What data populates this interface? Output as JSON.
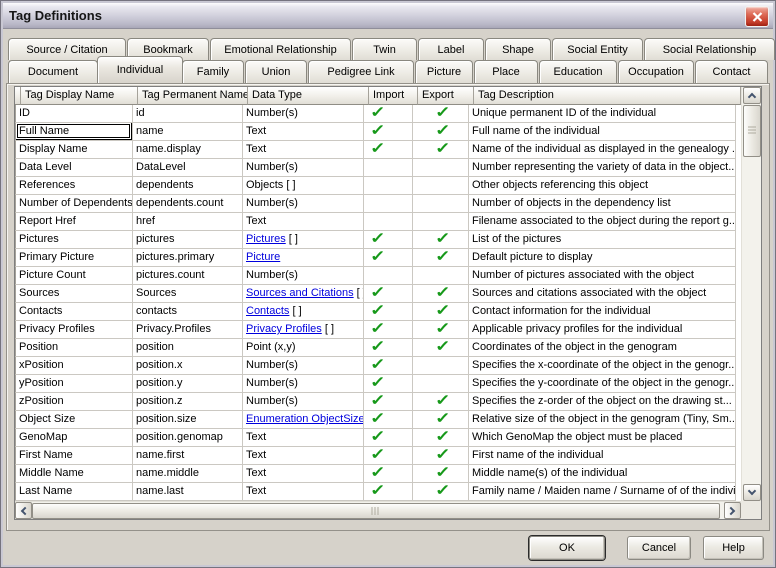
{
  "window": {
    "title": "Tag Definitions"
  },
  "tabs": {
    "row1": [
      "Source / Citation",
      "Bookmark",
      "Emotional Relationship",
      "Twin",
      "Label",
      "Shape",
      "Social Entity",
      "Social Relationship"
    ],
    "row2": [
      "Document",
      "Individual",
      "Family",
      "Union",
      "Pedigree Link",
      "Picture",
      "Place",
      "Education",
      "Occupation",
      "Contact"
    ],
    "selected": "Individual"
  },
  "table": {
    "columns": [
      "Tag Display Name",
      "Tag Permanent Name",
      "Data Type",
      "Import",
      "Export",
      "Tag Description"
    ],
    "rows": [
      {
        "display": "ID",
        "permanent": "id",
        "type_text": "Number(s)",
        "type_is_link": false,
        "type_suffix": "",
        "import": true,
        "export": true,
        "focused": false,
        "description": "Unique permanent ID of the individual"
      },
      {
        "display": "Full Name",
        "permanent": "name",
        "type_text": "Text",
        "type_is_link": false,
        "type_suffix": "",
        "import": true,
        "export": true,
        "focused": true,
        "description": "Full name of the individual"
      },
      {
        "display": "Display Name",
        "permanent": "name.display",
        "type_text": "Text",
        "type_is_link": false,
        "type_suffix": "",
        "import": true,
        "export": true,
        "focused": false,
        "description": "Name of the individual as displayed in the genealogy ..."
      },
      {
        "display": "Data Level",
        "permanent": "DataLevel",
        "type_text": "Number(s)",
        "type_is_link": false,
        "type_suffix": "",
        "import": false,
        "export": false,
        "focused": false,
        "description": "Number representing the variety of data in the object..."
      },
      {
        "display": "References",
        "permanent": "dependents",
        "type_text": "Objects [ ]",
        "type_is_link": false,
        "type_suffix": "",
        "import": false,
        "export": false,
        "focused": false,
        "description": "Other objects referencing this object"
      },
      {
        "display": "Number of Dependents",
        "permanent": "dependents.count",
        "type_text": "Number(s)",
        "type_is_link": false,
        "type_suffix": "",
        "import": false,
        "export": false,
        "focused": false,
        "description": "Number of objects in the dependency list"
      },
      {
        "display": "Report Href",
        "permanent": "href",
        "type_text": "Text",
        "type_is_link": false,
        "type_suffix": "",
        "import": false,
        "export": false,
        "focused": false,
        "description": "Filename associated to the object during the report g..."
      },
      {
        "display": "Pictures",
        "permanent": "pictures",
        "type_text": "Pictures",
        "type_is_link": true,
        "type_suffix": " [ ]",
        "import": true,
        "export": true,
        "focused": false,
        "description": "List of the pictures"
      },
      {
        "display": "Primary Picture",
        "permanent": "pictures.primary",
        "type_text": "Picture",
        "type_is_link": true,
        "type_suffix": "",
        "import": true,
        "export": true,
        "focused": false,
        "description": "Default picture to display"
      },
      {
        "display": "Picture Count",
        "permanent": "pictures.count",
        "type_text": "Number(s)",
        "type_is_link": false,
        "type_suffix": "",
        "import": false,
        "export": false,
        "focused": false,
        "description": "Number of pictures associated with the object"
      },
      {
        "display": "Sources",
        "permanent": "Sources",
        "type_text": "Sources and Citations",
        "type_is_link": true,
        "type_suffix": " [ ]",
        "import": true,
        "export": true,
        "focused": false,
        "description": "Sources and citations associated with the object"
      },
      {
        "display": "Contacts",
        "permanent": "contacts",
        "type_text": "Contacts",
        "type_is_link": true,
        "type_suffix": " [ ]",
        "import": true,
        "export": true,
        "focused": false,
        "description": "Contact information for the individual"
      },
      {
        "display": "Privacy Profiles",
        "permanent": "Privacy.Profiles",
        "type_text": "Privacy Profiles",
        "type_is_link": true,
        "type_suffix": " [ ]",
        "import": true,
        "export": true,
        "focused": false,
        "description": "Applicable privacy profiles for the individual"
      },
      {
        "display": "Position",
        "permanent": "position",
        "type_text": "Point (x,y)",
        "type_is_link": false,
        "type_suffix": "",
        "import": true,
        "export": true,
        "focused": false,
        "description": "Coordinates of the object in the genogram"
      },
      {
        "display": "xPosition",
        "permanent": "position.x",
        "type_text": "Number(s)",
        "type_is_link": false,
        "type_suffix": "",
        "import": true,
        "export": false,
        "focused": false,
        "description": "Specifies the x-coordinate of the object in the genogr..."
      },
      {
        "display": "yPosition",
        "permanent": "position.y",
        "type_text": "Number(s)",
        "type_is_link": false,
        "type_suffix": "",
        "import": true,
        "export": false,
        "focused": false,
        "description": "Specifies the y-coordinate of the object in the genogr..."
      },
      {
        "display": "zPosition",
        "permanent": "position.z",
        "type_text": "Number(s)",
        "type_is_link": false,
        "type_suffix": "",
        "import": true,
        "export": true,
        "focused": false,
        "description": "Specifies the z-order of the object on the drawing st..."
      },
      {
        "display": "Object Size",
        "permanent": "position.size",
        "type_text": "Enumeration ObjectSize..",
        "type_is_link": true,
        "type_suffix": "",
        "import": true,
        "export": true,
        "focused": false,
        "description": "Relative size of the object in the genogram (Tiny, Sm..."
      },
      {
        "display": "GenoMap",
        "permanent": "position.genomap",
        "type_text": "Text",
        "type_is_link": false,
        "type_suffix": "",
        "import": true,
        "export": true,
        "focused": false,
        "description": "Which GenoMap the object must be placed"
      },
      {
        "display": "First Name",
        "permanent": "name.first",
        "type_text": "Text",
        "type_is_link": false,
        "type_suffix": "",
        "import": true,
        "export": true,
        "focused": false,
        "description": "First name of the individual"
      },
      {
        "display": "Middle Name",
        "permanent": "name.middle",
        "type_text": "Text",
        "type_is_link": false,
        "type_suffix": "",
        "import": true,
        "export": true,
        "focused": false,
        "description": "Middle name(s) of the individual"
      },
      {
        "display": "Last Name",
        "permanent": "name.last",
        "type_text": "Text",
        "type_is_link": false,
        "type_suffix": "",
        "import": true,
        "export": true,
        "focused": false,
        "description": "Family name / Maiden name / Surname of of the indivi..."
      }
    ]
  },
  "buttons": {
    "ok": "OK",
    "cancel": "Cancel",
    "help": "Help"
  },
  "icons": {
    "check": "✓"
  },
  "colors": {
    "link_blue": "#0000dd",
    "check_green": "#17991a",
    "close_red": "#cc4632",
    "dialog_bg": "#d6d2ca"
  }
}
